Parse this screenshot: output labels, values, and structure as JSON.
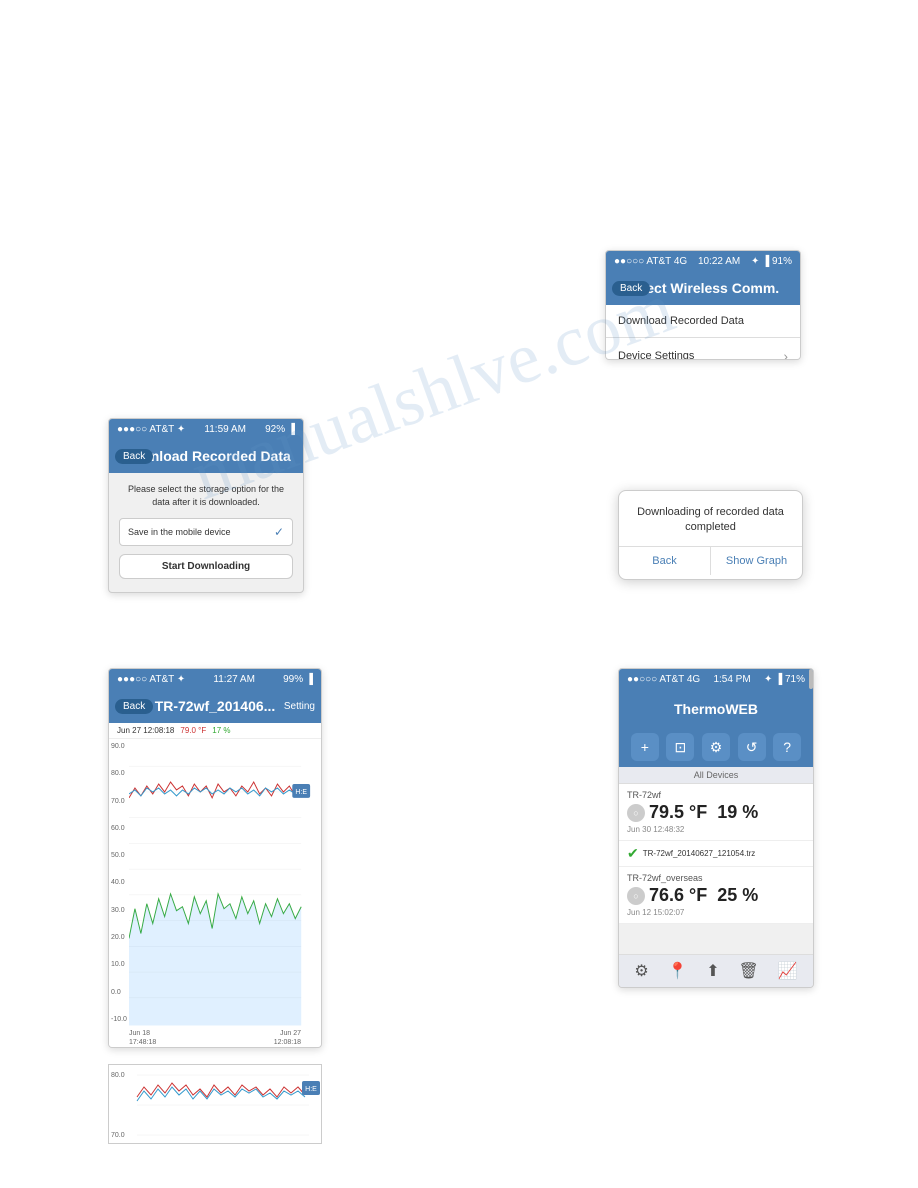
{
  "watermark": "manualshlve.com",
  "screen1": {
    "status": "●●●○○ AT&T ✦  11:59 AM         92%",
    "status_left": "●●●○○ AT&T ✦",
    "status_center": "11:59 AM",
    "status_right": "92% ▐",
    "back": "Back",
    "title": "Download Recorded Data",
    "description": "Please select the storage option for the data after it is downloaded.",
    "option_label": "Save in the mobile device",
    "start_btn": "Start Downloading"
  },
  "screen2": {
    "status_left": "●●○○○ AT&T 4G",
    "status_center": "10:22 AM",
    "status_right": "✦ ▐ 91%",
    "back": "Back",
    "title": "Direct Wireless Comm.",
    "menu_items": [
      {
        "label": "Download Recorded Data",
        "has_chevron": false
      },
      {
        "label": "Device Settings",
        "has_chevron": true
      }
    ]
  },
  "screen3": {
    "message": "Downloading of recorded data completed",
    "back_btn": "Back",
    "show_graph_btn": "Show Graph"
  },
  "screen4": {
    "status_left": "●●●○○ AT&T ✦",
    "status_center": "11:27 AM",
    "status_right": "99% ▐",
    "back": "Back",
    "title": "TR-72wf_201406...",
    "setting": "Setting",
    "graph_header": "Jun 27 12:08:18",
    "graph_temp": "79.0 °F",
    "graph_humid": "17 %",
    "y_labels": [
      "90.0",
      "80.0",
      "70.0",
      "60.0",
      "50.0",
      "40.0",
      "30.0",
      "20.0",
      "10.0",
      "0.0",
      "-10.0"
    ],
    "x_labels": [
      "Jun 18\n17:48:18",
      "Jun 27\n12:08:18"
    ]
  },
  "screen5": {
    "status_left": "●●○○○ AT&T 4G",
    "status_center": "1:54 PM",
    "status_right": "✦ ▐ 71%",
    "title": "ThermoWEB",
    "toolbar_icons": [
      "+",
      "📺",
      "⚙",
      "↺",
      "?"
    ],
    "section_label": "All Devices",
    "devices": [
      {
        "name": "TR-72wf",
        "temp": "79.5 °F",
        "humid": "19 %",
        "date": "Jun 30 12:48:32",
        "active": false
      }
    ],
    "file_name": "TR-72wf_20140627_121054.trz",
    "device2": {
      "name": "TR-72wf_overseas",
      "temp": "76.6 °F",
      "humid": "25 %",
      "date": "Jun 12 15:02:07",
      "active": false
    },
    "bottom_icons": [
      "⚙",
      "📍",
      "↑",
      "🗑",
      "📈"
    ]
  }
}
